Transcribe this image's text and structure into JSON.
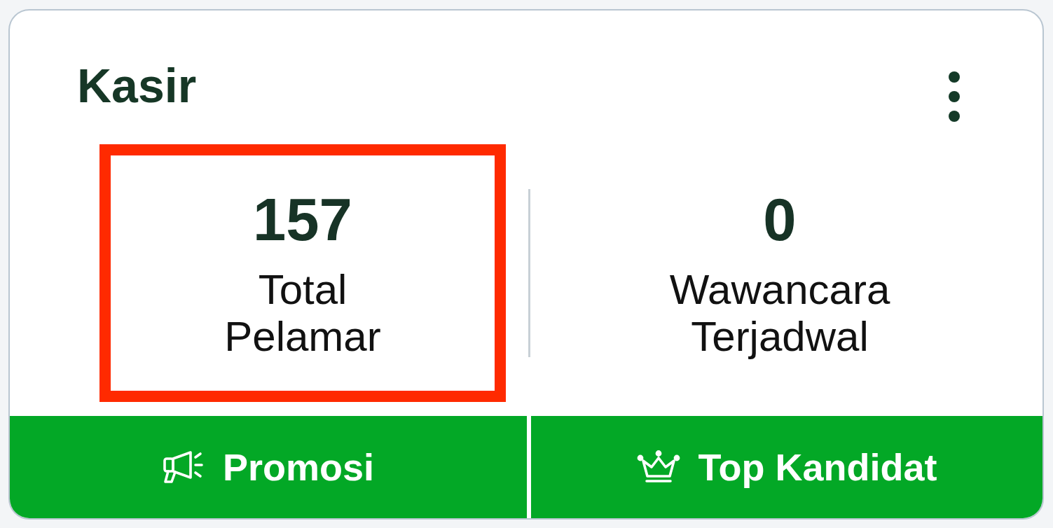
{
  "card": {
    "title": "Kasir",
    "stats": [
      {
        "value": "157",
        "label": "Total Pelamar",
        "highlighted": true
      },
      {
        "value": "0",
        "label": "Wawancara Terjadwal",
        "highlighted": false
      }
    ],
    "actions": [
      {
        "label": "Promosi",
        "kind": "promotion"
      },
      {
        "label": "Top Kandidat",
        "kind": "ranking"
      }
    ]
  }
}
